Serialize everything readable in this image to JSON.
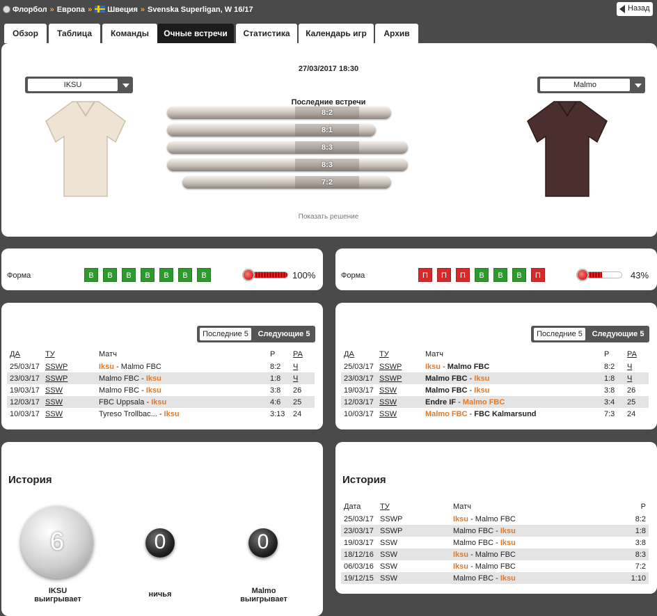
{
  "breadcrumb": [
    "Флорбол",
    "Европа",
    "Швеция",
    "Svenska Superligan, W 16/17"
  ],
  "back_label": "Назад",
  "tabs": [
    "Обзор",
    "Таблица",
    "Команды",
    "Очные встречи",
    "Статистика",
    "Календарь игр",
    "Архив"
  ],
  "active_tab": "Очные встречи",
  "match": {
    "datetime": "27/03/2017 18:30",
    "home_team": "IKSU",
    "away_team": "Malmo",
    "home_shirt_color": "#efe3d4",
    "away_shirt_color": "#4a2f2e",
    "last_meetings_title": "Последние встречи",
    "last_meetings": [
      "8:2",
      "8:1",
      "8:3",
      "8:3",
      "7:2"
    ],
    "show_solution": "Показать решение"
  },
  "form": {
    "label": "Форма",
    "home": {
      "results": [
        "В",
        "В",
        "В",
        "В",
        "В",
        "В",
        "В"
      ],
      "percent": 100,
      "percent_label": "100%"
    },
    "away": {
      "results": [
        "П",
        "П",
        "П",
        "В",
        "В",
        "В",
        "П"
      ],
      "percent": 43,
      "percent_label": "43%"
    }
  },
  "colors": {
    "win": "#2e9a2e",
    "loss": "#d42a2a",
    "accent": "#e07a2a",
    "background": "#4a4a4a"
  },
  "recent": {
    "toggle": [
      "Последние 5",
      "Следующие 5"
    ],
    "headers": [
      "ДА",
      "ТУ",
      "Матч",
      "Р",
      "РА"
    ],
    "home": [
      {
        "date": "25/03/17",
        "tour": "SSWP",
        "match_a": "Iksu",
        "match_b": "Malmo FBC",
        "hl": "a",
        "score": "8:2",
        "ra": "Ч"
      },
      {
        "date": "23/03/17",
        "tour": "SSWP",
        "match_a": "Malmo FBC",
        "match_b": "Iksu",
        "hl": "b",
        "score": "1:8",
        "ra": "Ч"
      },
      {
        "date": "19/03/17",
        "tour": "SSW",
        "match_a": "Malmo FBC",
        "match_b": "Iksu",
        "hl": "b",
        "score": "3:8",
        "ra": "26"
      },
      {
        "date": "12/03/17",
        "tour": "SSW",
        "match_a": "FBC Uppsala",
        "match_b": "Iksu",
        "hl": "b",
        "score": "4:6",
        "ra": "25"
      },
      {
        "date": "10/03/17",
        "tour": "SSW",
        "match_a": "Tyreso Trollbac...",
        "match_b": "Iksu",
        "hl": "b",
        "score": "3:13",
        "ra": "24"
      }
    ],
    "away": [
      {
        "date": "25/03/17",
        "tour": "SSWP",
        "match_a": "Iksu",
        "match_b": "Malmo FBC",
        "hl": "a",
        "score": "8:2",
        "ra": "Ч"
      },
      {
        "date": "23/03/17",
        "tour": "SSWP",
        "match_a": "Malmo FBC",
        "match_b": "Iksu",
        "hl": "b",
        "score": "1:8",
        "ra": "Ч"
      },
      {
        "date": "19/03/17",
        "tour": "SSW",
        "match_a": "Malmo FBC",
        "match_b": "Iksu",
        "hl": "b",
        "score": "3:8",
        "ra": "26"
      },
      {
        "date": "12/03/17",
        "tour": "SSW",
        "match_a": "Endre IF",
        "match_b": "Malmo FBC",
        "hl": "b",
        "score": "3:4",
        "ra": "25"
      },
      {
        "date": "10/03/17",
        "tour": "SSW",
        "match_a": "Malmo FBC",
        "match_b": "FBC Kalmarsund",
        "hl": "a",
        "score": "7:3",
        "ra": "24"
      }
    ]
  },
  "history": {
    "title": "История",
    "home_wins": "6",
    "draws": "0",
    "away_wins": "0",
    "home_label_1": "IKSU",
    "home_label_2": "выигрывает",
    "draw_label": "ничья",
    "away_label_1": "Malmo",
    "away_label_2": "выигрывает",
    "headers": [
      "Дата",
      "ТУ",
      "Матч",
      "Р"
    ],
    "rows": [
      {
        "date": "25/03/17",
        "tour": "SSWP",
        "match_a": "Iksu",
        "match_b": "Malmo FBC",
        "hl": "a",
        "score": "8:2"
      },
      {
        "date": "23/03/17",
        "tour": "SSWP",
        "match_a": "Malmo FBC",
        "match_b": "Iksu",
        "hl": "b",
        "score": "1:8"
      },
      {
        "date": "19/03/17",
        "tour": "SSW",
        "match_a": "Malmo FBC",
        "match_b": "Iksu",
        "hl": "b",
        "score": "3:8"
      },
      {
        "date": "18/12/16",
        "tour": "SSW",
        "match_a": "Iksu",
        "match_b": "Malmo FBC",
        "hl": "a",
        "score": "8:3"
      },
      {
        "date": "06/03/16",
        "tour": "SSW",
        "match_a": "Iksu",
        "match_b": "Malmo FBC",
        "hl": "a",
        "score": "7:2"
      },
      {
        "date": "19/12/15",
        "tour": "SSW",
        "match_a": "Malmo FBC",
        "match_b": "Iksu",
        "hl": "b",
        "score": "1:10"
      }
    ]
  }
}
